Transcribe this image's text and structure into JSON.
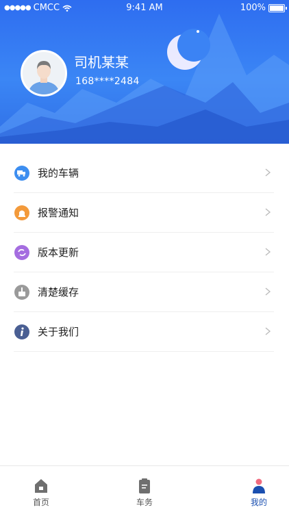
{
  "status_bar": {
    "carrier": "CMCC",
    "time": "9:41 AM",
    "battery": "100%"
  },
  "profile": {
    "name": "司机某某",
    "phone": "168****2484"
  },
  "menu": [
    {
      "label": "我的车辆",
      "icon": "truck-icon",
      "color": "#3d8ef0"
    },
    {
      "label": "报警通知",
      "icon": "alarm-icon",
      "color": "#f39a3b"
    },
    {
      "label": "版本更新",
      "icon": "refresh-icon",
      "color": "#a56de0"
    },
    {
      "label": "清楚缓存",
      "icon": "broom-icon",
      "color": "#9a9a9a"
    },
    {
      "label": "关于我们",
      "icon": "info-icon",
      "color": "#4a5f93"
    }
  ],
  "tabs": [
    {
      "label": "首页",
      "icon": "home-icon"
    },
    {
      "label": "车务",
      "icon": "clipboard-icon"
    },
    {
      "label": "我的",
      "icon": "person-icon",
      "active": true
    }
  ],
  "colors": {
    "header_blue": "#2e6df0",
    "active_tab": "#1a4fb0"
  }
}
